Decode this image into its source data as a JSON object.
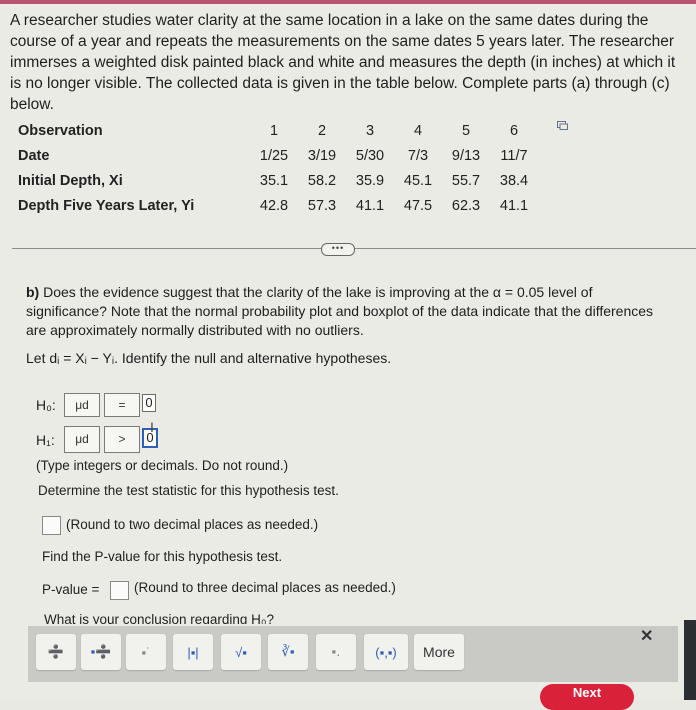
{
  "intro": "A researcher studies water clarity at the same location in a lake on the same dates during the course of a year and repeats the measurements on the same dates 5 years later. The researcher immerses a weighted disk painted black and white and measures the depth (in inches) at which it is no longer visible. The collected data is given in the table below. Complete parts (a) through (c) below.",
  "table": {
    "rows": [
      {
        "label": "Observation",
        "values": [
          "1",
          "2",
          "3",
          "4",
          "5",
          "6"
        ]
      },
      {
        "label": "Date",
        "values": [
          "1/25",
          "3/19",
          "5/30",
          "7/3",
          "9/13",
          "11/7"
        ]
      },
      {
        "label": "Initial Depth, Xi",
        "values": [
          "35.1",
          "58.2",
          "35.9",
          "45.1",
          "55.7",
          "38.4"
        ]
      },
      {
        "label": "Depth Five Years Later, Yi",
        "values": [
          "42.8",
          "57.3",
          "41.1",
          "47.5",
          "62.3",
          "41.1"
        ]
      }
    ]
  },
  "expand_button": "•••",
  "question_b": {
    "prefix": "b)",
    "text": " Does the evidence suggest that the clarity of the lake is improving at the α = 0.05 level of significance? Note that the normal probability plot and boxplot of the data indicate that the differences are approximately normally distributed with no outliers.",
    "let_line": "Let dᵢ = Xᵢ − Yᵢ. Identify the null and alternative hypotheses."
  },
  "hypotheses": {
    "h0_label": "H₀:",
    "h0_param": "μd",
    "h0_op": "=",
    "h0_value": "0",
    "h1_label": "H₁:",
    "h1_param": "μd",
    "h1_op": ">",
    "h1_value": "0"
  },
  "hint_integers": "(Type integers or decimals. Do not round.)",
  "test_stat_prompt": "Determine the test statistic for this hypothesis test.",
  "test_stat_hint": "(Round to two decimal places as needed.)",
  "pvalue_prompt": "Find the P-value for this hypothesis test.",
  "pvalue_label": "P-value =",
  "pvalue_hint": "(Round to three decimal places as needed.)",
  "conclusion_prompt": "What is your conclusion regarding H₀?",
  "toolbar": {
    "buttons": [
      "fraction",
      "mixed-number",
      "exponent",
      "absolute-value",
      "square-root",
      "nth-root",
      "subscript",
      "ordered-pair"
    ],
    "glyphs": [
      "➗",
      "▪➗",
      "▪˙",
      "|▪|",
      "√▪",
      "∛▪",
      "▪․",
      "(▪,▪)"
    ],
    "more_label": "More",
    "close": "✕"
  },
  "next_label": "Next"
}
